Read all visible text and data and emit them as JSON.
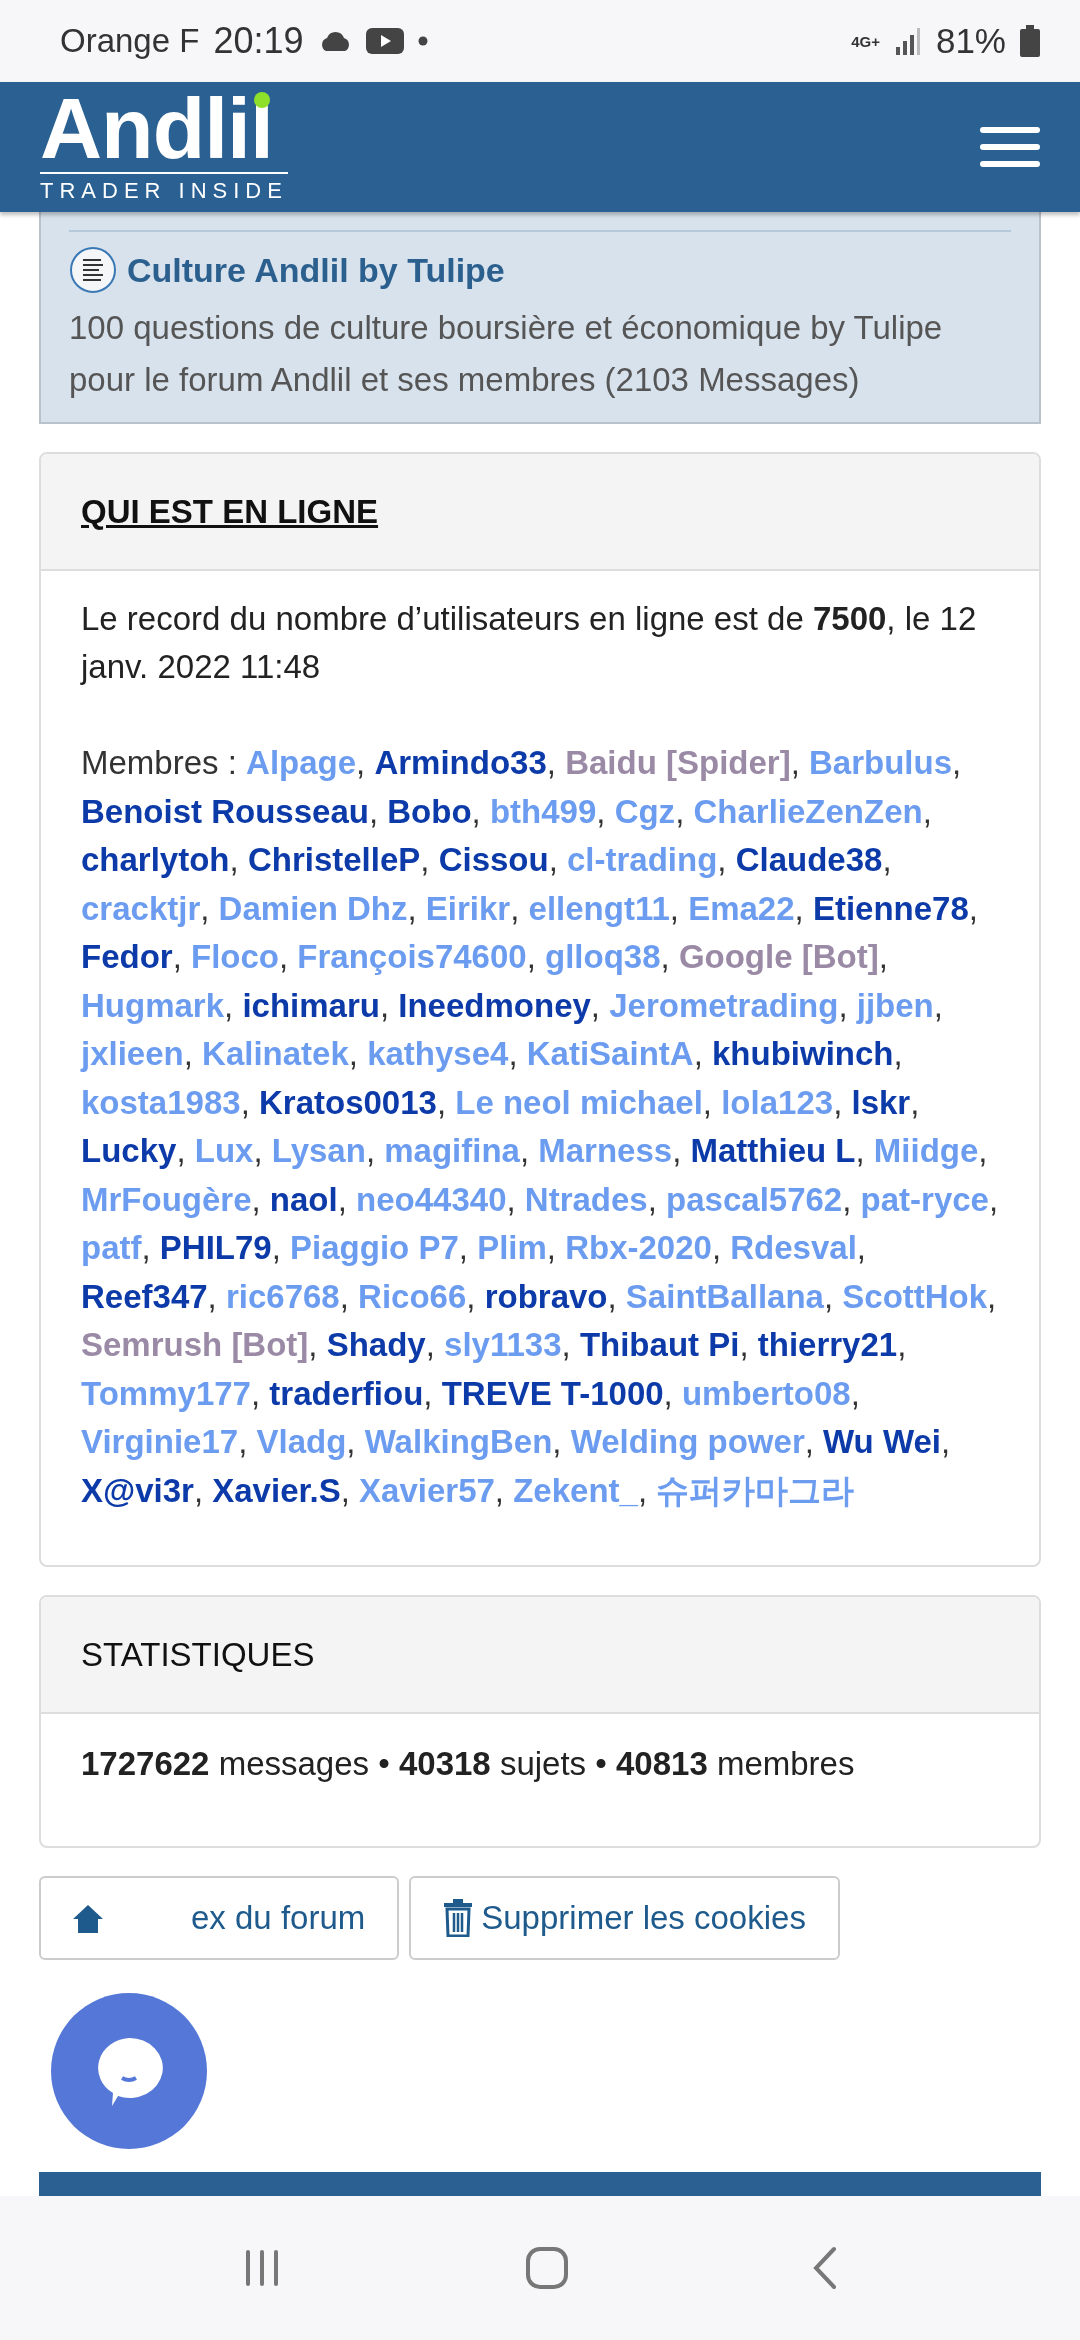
{
  "status_bar": {
    "carrier": "Orange F",
    "time": "20:19",
    "network": "4G+",
    "battery": "81%"
  },
  "header": {
    "logo": "Andlil",
    "tagline": "TRADER INSIDE"
  },
  "forum": {
    "title": "Culture Andlil by Tulipe",
    "description": "100 questions de culture boursière et économique by Tulipe pour le forum Andlil et ses membres (2103 Messages)"
  },
  "online": {
    "heading": "QUI EST EN LIGNE",
    "record": "Le record du nombre d’utilisateurs en ligne est de **7500**, le 12 janv. 2022 11:48",
    "members_label": "Membres :",
    "separator": ",",
    "members": [
      {
        "name": "Alpage",
        "color": "#6b9cf0"
      },
      {
        "name": "Armindo33",
        "color": "#0c3aa8"
      },
      {
        "name": "Baidu [Spider]",
        "color": "#9a8aa6"
      },
      {
        "name": "Barbulus",
        "color": "#6b9cf0"
      },
      {
        "name": "Benoist Rousseau",
        "color": "#0c3aa8"
      },
      {
        "name": "Bobo",
        "color": "#0c3aa8"
      },
      {
        "name": "bth499",
        "color": "#6b9cf0"
      },
      {
        "name": "Cgz",
        "color": "#6b9cf0"
      },
      {
        "name": "CharlieZenZen",
        "color": "#6b9cf0"
      },
      {
        "name": "charlytoh",
        "color": "#0c3aa8"
      },
      {
        "name": "ChristelleP",
        "color": "#0c3aa8"
      },
      {
        "name": "Cissou",
        "color": "#0c3aa8"
      },
      {
        "name": "cl-trading",
        "color": "#6b9cf0"
      },
      {
        "name": "Claude38",
        "color": "#0c3aa8"
      },
      {
        "name": "cracktjr",
        "color": "#6b9cf0"
      },
      {
        "name": "Damien Dhz",
        "color": "#6b9cf0"
      },
      {
        "name": "Eirikr",
        "color": "#6b9cf0"
      },
      {
        "name": "ellengt11",
        "color": "#6b9cf0"
      },
      {
        "name": "Ema22",
        "color": "#6b9cf0"
      },
      {
        "name": "Etienne78",
        "color": "#0c3aa8"
      },
      {
        "name": "Fedor",
        "color": "#0c3aa8"
      },
      {
        "name": "Floco",
        "color": "#6b9cf0"
      },
      {
        "name": "François74600",
        "color": "#6b9cf0"
      },
      {
        "name": "glloq38",
        "color": "#6b9cf0"
      },
      {
        "name": "Google [Bot]",
        "color": "#9a8aa6"
      },
      {
        "name": "Hugmark",
        "color": "#6b9cf0"
      },
      {
        "name": "ichimaru",
        "color": "#0c3aa8"
      },
      {
        "name": "Ineedmoney",
        "color": "#0c3aa8"
      },
      {
        "name": "Jerometrading",
        "color": "#6b9cf0"
      },
      {
        "name": "jjben",
        "color": "#6b9cf0"
      },
      {
        "name": "jxlieen",
        "color": "#6b9cf0"
      },
      {
        "name": "Kalinatek",
        "color": "#6b9cf0"
      },
      {
        "name": "kathyse4",
        "color": "#6b9cf0"
      },
      {
        "name": "KatiSaintA",
        "color": "#6b9cf0"
      },
      {
        "name": "khubiwinch",
        "color": "#0c3aa8"
      },
      {
        "name": "kosta1983",
        "color": "#6b9cf0"
      },
      {
        "name": "Kratos0013",
        "color": "#0c3aa8"
      },
      {
        "name": "Le neol michael",
        "color": "#6b9cf0"
      },
      {
        "name": "lola123",
        "color": "#6b9cf0"
      },
      {
        "name": "lskr",
        "color": "#0c3aa8"
      },
      {
        "name": "Lucky",
        "color": "#0c3aa8"
      },
      {
        "name": "Lux",
        "color": "#6b9cf0"
      },
      {
        "name": "Lysan",
        "color": "#6b9cf0"
      },
      {
        "name": "magifina",
        "color": "#6b9cf0"
      },
      {
        "name": "Marness",
        "color": "#6b9cf0"
      },
      {
        "name": "Matthieu L",
        "color": "#0c3aa8"
      },
      {
        "name": "Miidge",
        "color": "#6b9cf0"
      },
      {
        "name": "MrFougère",
        "color": "#6b9cf0"
      },
      {
        "name": "naol",
        "color": "#0c3aa8"
      },
      {
        "name": "neo44340",
        "color": "#6b9cf0"
      },
      {
        "name": "Ntrades",
        "color": "#6b9cf0"
      },
      {
        "name": "pascal5762",
        "color": "#6b9cf0"
      },
      {
        "name": "pat-ryce",
        "color": "#6b9cf0"
      },
      {
        "name": "patf",
        "color": "#6b9cf0"
      },
      {
        "name": "PHIL79",
        "color": "#0c3aa8"
      },
      {
        "name": "Piaggio P7",
        "color": "#6b9cf0"
      },
      {
        "name": "Plim",
        "color": "#6b9cf0"
      },
      {
        "name": "Rbx-2020",
        "color": "#6b9cf0"
      },
      {
        "name": "Rdesval",
        "color": "#6b9cf0"
      },
      {
        "name": "Reef347",
        "color": "#0c3aa8"
      },
      {
        "name": "ric6768",
        "color": "#6b9cf0"
      },
      {
        "name": "Rico66",
        "color": "#6b9cf0"
      },
      {
        "name": "robravo",
        "color": "#0c3aa8"
      },
      {
        "name": "SaintBallana",
        "color": "#6b9cf0"
      },
      {
        "name": "ScottHok",
        "color": "#6b9cf0"
      },
      {
        "name": "Semrush [Bot]",
        "color": "#9a8aa6"
      },
      {
        "name": "Shady",
        "color": "#0c3aa8"
      },
      {
        "name": "sly1133",
        "color": "#6b9cf0"
      },
      {
        "name": "Thibaut Pi",
        "color": "#0c3aa8"
      },
      {
        "name": "thierry21",
        "color": "#0c3aa8"
      },
      {
        "name": "Tommy177",
        "color": "#6b9cf0"
      },
      {
        "name": "traderfiou",
        "color": "#0c3aa8"
      },
      {
        "name": "TREVE T-1000",
        "color": "#0c3aa8"
      },
      {
        "name": "umberto08",
        "color": "#6b9cf0"
      },
      {
        "name": "Virginie17",
        "color": "#6b9cf0"
      },
      {
        "name": "Vladg",
        "color": "#6b9cf0"
      },
      {
        "name": "WalkingBen",
        "color": "#6b9cf0"
      },
      {
        "name": "Welding power",
        "color": "#6b9cf0"
      },
      {
        "name": "Wu Wei",
        "color": "#0c3aa8"
      },
      {
        "name": "X@vi3r",
        "color": "#0c3aa8"
      },
      {
        "name": "Xavier.S",
        "color": "#0c3aa8"
      },
      {
        "name": "Xavier57",
        "color": "#6b9cf0"
      },
      {
        "name": "Zekent_",
        "color": "#6b9cf0"
      },
      {
        "name": "슈퍼카마그라",
        "color": "#6b9cf0"
      }
    ]
  },
  "statistics": {
    "heading": "STATISTIQUES",
    "text": "**1727622** messages • **40318** sujets • **40813** membres"
  },
  "buttons": [
    {
      "kind": "home",
      "label": "ex du forum"
    },
    {
      "kind": "delete",
      "label": "Supprimer les cookies"
    }
  ]
}
